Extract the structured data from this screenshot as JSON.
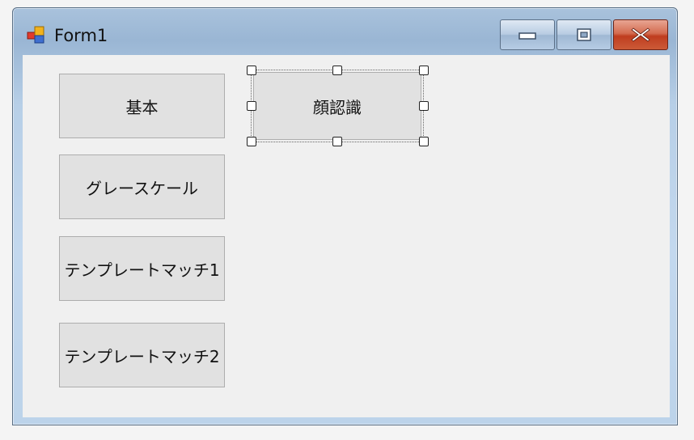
{
  "window": {
    "title": "Form1",
    "controls": {
      "minimize_icon": "minimize-icon",
      "maximize_icon": "maximize-icon",
      "close_icon": "close-icon"
    }
  },
  "form": {
    "buttons": [
      {
        "label": "基本"
      },
      {
        "label": "グレースケール"
      },
      {
        "label": "テンプレートマッチ1"
      },
      {
        "label": "テンプレートマッチ2"
      },
      {
        "label": "顔認識",
        "selected": true
      }
    ]
  },
  "colors": {
    "close_button": "#c9472a",
    "client_background": "#f0f0f0",
    "button_face": "#e1e1e1"
  }
}
